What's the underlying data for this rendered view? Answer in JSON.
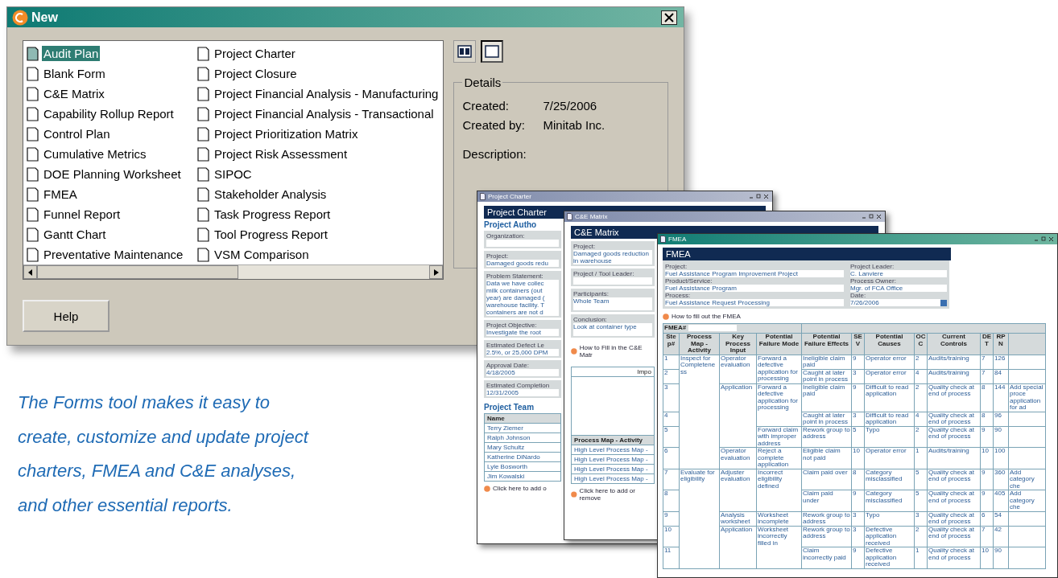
{
  "dialog": {
    "title": "New",
    "forms": [
      {
        "label": "Audit Plan",
        "selected": true
      },
      {
        "label": "Blank Form",
        "selected": false
      },
      {
        "label": "C&E Matrix",
        "selected": false
      },
      {
        "label": "Capability Rollup Report",
        "selected": false
      },
      {
        "label": "Control Plan",
        "selected": false
      },
      {
        "label": "Cumulative Metrics",
        "selected": false
      },
      {
        "label": "DOE Planning Worksheet",
        "selected": false
      },
      {
        "label": "FMEA",
        "selected": false
      },
      {
        "label": "Funnel Report",
        "selected": false
      },
      {
        "label": "Gantt Chart",
        "selected": false
      },
      {
        "label": "Preventative Maintenance",
        "selected": false
      },
      {
        "label": "Project Charter",
        "selected": false
      },
      {
        "label": "Project Closure",
        "selected": false
      },
      {
        "label": "Project Financial Analysis - Manufacturing",
        "selected": false
      },
      {
        "label": "Project Financial Analysis - Transactional",
        "selected": false
      },
      {
        "label": "Project Prioritization Matrix",
        "selected": false
      },
      {
        "label": "Project Risk Assessment",
        "selected": false
      },
      {
        "label": "SIPOC",
        "selected": false
      },
      {
        "label": "Stakeholder Analysis",
        "selected": false
      },
      {
        "label": "Task Progress Report",
        "selected": false
      },
      {
        "label": "Tool Progress Report",
        "selected": false
      },
      {
        "label": "VSM Comparison",
        "selected": false
      }
    ],
    "views": [
      {
        "kind": "details",
        "selected": false
      },
      {
        "kind": "list",
        "selected": true
      }
    ],
    "details": {
      "legend": "Details",
      "fields": [
        {
          "label": "Created:",
          "value": "7/25/2006"
        },
        {
          "label": "Created by:",
          "value": "Minitab Inc."
        },
        {
          "label": "Description:"
        }
      ]
    },
    "help_button": "Help"
  },
  "caption": "The Forms tool makes it easy to\ncreate, customize and update project\ncharters, FMEA and C&E analyses,\nand other essential reports.",
  "charter": {
    "title": "Project Charter",
    "heading": "Project Charter",
    "section": "Project Autho",
    "fields": [
      {
        "label": "Organization:"
      },
      {
        "label": "Project:",
        "value": "Damaged goods redu"
      },
      {
        "label": "Problem Statement:",
        "value": "Data we have collec\nmilk containers (out\nyear) are damaged (\nwarehouse facility. T\ncontainers are not d"
      },
      {
        "label": "Project Objective:",
        "value": "Investigate the root"
      },
      {
        "label": "Estimated Defect Le",
        "value": "2.5%, or 25,000 DPM"
      },
      {
        "label": "Approval Date:",
        "value": "4/18/2005"
      },
      {
        "label": "Estimated Completion",
        "value": "12/31/2005"
      }
    ],
    "team_heading": "Project Team",
    "team_column": "Name",
    "team": [
      "Terry Ziemer",
      "Ralph Johnson",
      "Mary Schultz",
      "Katherine DiNardo",
      "Lyle Bosworth",
      "Jim Kowalski"
    ],
    "link": "Click here to add o"
  },
  "ce_matrix": {
    "title": "C&E Matrix",
    "heading": "C&E Matrix",
    "leader_label": "Project / Tool Leader:",
    "fields": [
      {
        "label": "Project:",
        "value": "Damaged goods reduction in warehouse"
      },
      {
        "label": "Participants:",
        "value": "Whole Team"
      },
      {
        "label": "Conclusion:",
        "value": "Look at container type"
      }
    ],
    "link": "How to Fill in the C&E Matr",
    "table_header": "Impo",
    "activity_column": "Process Map - Activity",
    "activities": [
      "High Level Process Map -",
      "High Level Process Map -",
      "High Level Process Map -",
      "High Level Process Map -"
    ],
    "add_link": "Click here to add or remove"
  },
  "fmea": {
    "title": "FMEA",
    "heading": "FMEA",
    "fields_left": [
      {
        "label": "Project:",
        "value": "Fuel Assistance Program Improvement Project"
      },
      {
        "label": "Product/Service:",
        "value": "Fuel Assistance Program"
      },
      {
        "label": "Process:",
        "value": "Fuel Assistance Request Processing"
      }
    ],
    "fields_right": [
      {
        "label": "Project Leader:",
        "value": "C. Lanviere"
      },
      {
        "label": "Process Owner:",
        "value": "Mgr. of FCA Office"
      },
      {
        "label": "Date:",
        "value": "7/26/2006"
      }
    ],
    "link": "How to fill out the FMEA",
    "number_label": "FMEA#",
    "columns": [
      "Step#",
      "Process Map - Activity",
      "Key Process Input",
      "Potential Failure Mode",
      "Potential Failure Effects",
      "SEV",
      "Potential Causes",
      "OCC",
      "Current Controls",
      "DET",
      "RPN"
    ],
    "groups": [
      {
        "activity": "Inspect for Completeness",
        "inputs": [
          {
            "input": "Operator evaluation",
            "modes": [
              {
                "mode": "Forward a defective application for processing",
                "effects": [
                  {
                    "step": "1",
                    "effect": "Ineligible claim paid",
                    "sev": "9",
                    "cause": "Operator error",
                    "occ": "2",
                    "controls": "Audits/training",
                    "det": "7",
                    "rpn": "126"
                  },
                  {
                    "step": "2",
                    "effect": "Caught at later point in process",
                    "sev": "3",
                    "cause": "Operator error",
                    "occ": "4",
                    "controls": "Audits/training",
                    "det": "7",
                    "rpn": "84"
                  }
                ]
              }
            ]
          },
          {
            "input": "Application",
            "modes": [
              {
                "mode": "Forward a defective application for processing",
                "effects": [
                  {
                    "step": "3",
                    "effect": "Ineligible claim paid",
                    "sev": "9",
                    "cause": "Difficult to read application",
                    "occ": "2",
                    "controls": "Quality check at end of process",
                    "det": "8",
                    "rpn": "144",
                    "action": "Add special proce application for ad"
                  },
                  {
                    "step": "4",
                    "effect": "Caught at later point in process",
                    "sev": "3",
                    "cause": "Difficult to read application",
                    "occ": "4",
                    "controls": "Quality check at end of process",
                    "det": "8",
                    "rpn": "96"
                  }
                ]
              },
              {
                "mode": "Forward claim with improper address",
                "effects": [
                  {
                    "step": "5",
                    "effect": "Rework group to address",
                    "sev": "5",
                    "cause": "Typo",
                    "occ": "2",
                    "controls": "Quality check at end of process",
                    "det": "9",
                    "rpn": "90"
                  }
                ]
              }
            ]
          },
          {
            "input": "Operator evaluation",
            "modes": [
              {
                "mode": "Reject a complete application",
                "effects": [
                  {
                    "step": "6",
                    "effect": "Eligible claim not paid",
                    "sev": "10",
                    "cause": "Operator error",
                    "occ": "1",
                    "controls": "Audits/training",
                    "det": "10",
                    "rpn": "100"
                  }
                ]
              }
            ]
          }
        ]
      },
      {
        "activity": "Evaluate for eligibility",
        "inputs": [
          {
            "input": "Adjuster evaluation",
            "modes": [
              {
                "mode": "Incorrect eligibility defined",
                "effects": [
                  {
                    "step": "7",
                    "effect": "Claim paid over",
                    "sev": "8",
                    "cause": "Category misclassified",
                    "occ": "5",
                    "controls": "Quality check at end of process",
                    "det": "9",
                    "rpn": "360",
                    "action": "Add category che"
                  },
                  {
                    "step": "8",
                    "effect": "Claim paid under",
                    "sev": "9",
                    "cause": "Category misclassified",
                    "occ": "5",
                    "controls": "Quality check at end of process",
                    "det": "9",
                    "rpn": "405",
                    "action": "Add category che"
                  }
                ]
              }
            ]
          },
          {
            "input": "Analysis worksheet",
            "modes": [
              {
                "mode": "Worksheet incomplete",
                "effects": [
                  {
                    "step": "9",
                    "effect": "Rework group to address",
                    "sev": "3",
                    "cause": "Typo",
                    "occ": "3",
                    "controls": "Quality check at end of process",
                    "det": "6",
                    "rpn": "54"
                  }
                ]
              }
            ]
          },
          {
            "input": "Application",
            "modes": [
              {
                "mode": "Worksheet incorrectly filled in",
                "effects": [
                  {
                    "step": "10",
                    "effect": "Rework group to address",
                    "sev": "3",
                    "cause": "Defective application received",
                    "occ": "2",
                    "controls": "Quality check at end of process",
                    "det": "7",
                    "rpn": "42"
                  },
                  {
                    "step": "11",
                    "effect": "Claim incorrectly paid",
                    "sev": "9",
                    "cause": "Defective application received",
                    "occ": "1",
                    "controls": "Quality check at end of process",
                    "det": "10",
                    "rpn": "90"
                  }
                ]
              }
            ]
          }
        ]
      }
    ]
  }
}
